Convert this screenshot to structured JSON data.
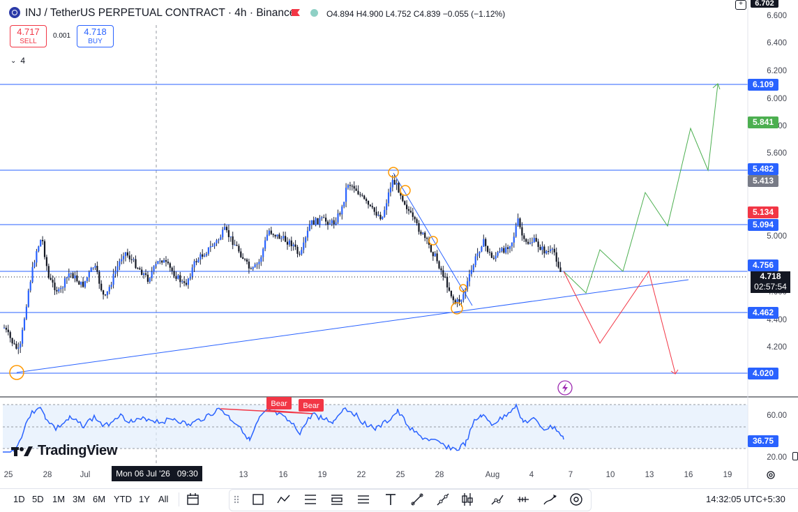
{
  "header": {
    "symbol_title": "INJ / TetherUS PERPETUAL CONTRACT · 4h · Binance",
    "ohlc": "O4.894 H4.900 L4.752 C4.839 −0.055 (−1.12%)",
    "sell_price": "4.717",
    "sell_label": "SELL",
    "spread": "0.001",
    "buy_price": "4.718",
    "buy_label": "BUY",
    "indicator_count": "4"
  },
  "price_scale": {
    "ticks": [
      "6.600",
      "6.400",
      "6.200",
      "6.000",
      "5.800",
      "5.600",
      "5.000",
      "4.600",
      "4.400",
      "4.200"
    ],
    "top_label": "6.702",
    "labels": [
      {
        "value": "6.109",
        "color": "#2962ff"
      },
      {
        "value": "5.841",
        "color": "#4caf50"
      },
      {
        "value": "5.482",
        "color": "#2962ff"
      },
      {
        "value": "5.413",
        "color": "#787b86"
      },
      {
        "value": "5.134",
        "color": "#f23645"
      },
      {
        "value": "5.094",
        "color": "#2962ff"
      },
      {
        "value": "4.756",
        "color": "#2962ff"
      },
      {
        "value": "4.462",
        "color": "#2962ff"
      },
      {
        "value": "4.020",
        "color": "#2962ff"
      }
    ],
    "current_price": "4.718",
    "countdown": "02:57:54"
  },
  "rsi": {
    "ticks": [
      "60.00",
      "20.00"
    ],
    "value_label": "36.75",
    "divergence_labels": [
      "Bear",
      "Bear"
    ]
  },
  "time_axis": {
    "ticks": [
      "25",
      "28",
      "Jul",
      "13",
      "16",
      "19",
      "22",
      "25",
      "28",
      "Aug",
      "4",
      "7",
      "10",
      "13",
      "16",
      "19"
    ],
    "crosshair_label": "Mon 06 Jul '26   09:30"
  },
  "branding": "TradingView",
  "toolbar": {
    "ranges": [
      "1D",
      "5D",
      "1M",
      "3M",
      "6M",
      "YTD",
      "1Y",
      "All"
    ],
    "clock": "14:32:05 UTC+5:30"
  },
  "colors": {
    "blue": "#2962ff",
    "green": "#4caf50",
    "red": "#f23645",
    "candle": "#1a2033",
    "rsi": "#2962ff",
    "orange": "#ff9800"
  }
}
